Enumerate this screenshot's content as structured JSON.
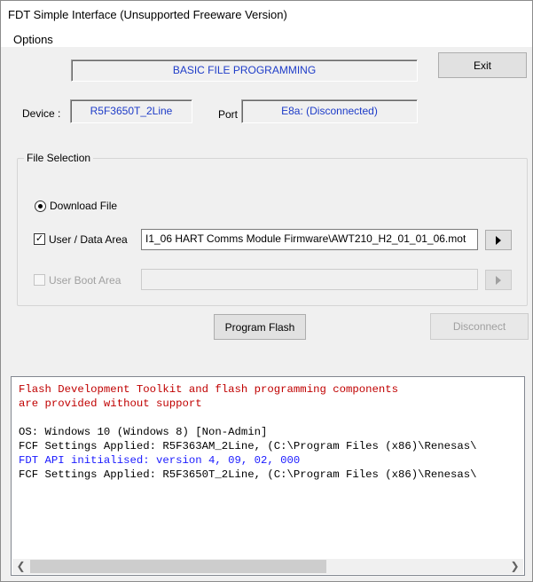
{
  "window": {
    "title": "FDT Simple Interface   (Unsupported Freeware Version)"
  },
  "menu": {
    "options": "Options"
  },
  "header": {
    "mode_text": "BASIC FILE PROGRAMMING",
    "exit_label": "Exit"
  },
  "device": {
    "label": "Device :",
    "value": "R5F3650T_2Line"
  },
  "port": {
    "label": "Port :",
    "value": "E8a: (Disconnected)"
  },
  "file_selection": {
    "title": "File Selection",
    "download_file_label": "Download File",
    "download_file_selected": true,
    "user_data_area": {
      "label": "User / Data Area",
      "checked": true,
      "path": "I1_06 HART Comms Module Firmware\\AWT210_H2_01_01_06.mot"
    },
    "user_boot_area": {
      "label": "User Boot Area",
      "checked": false,
      "enabled": false,
      "path": ""
    }
  },
  "actions": {
    "program_flash": "Program Flash",
    "disconnect": "Disconnect"
  },
  "log": {
    "lines": [
      {
        "text": "Flash Development Toolkit and flash programming components",
        "color": "#c00000"
      },
      {
        "text": "are provided without support",
        "color": "#c00000"
      },
      {
        "text": "",
        "color": "#000000"
      },
      {
        "text": "OS: Windows 10 (Windows 8) [Non-Admin]",
        "color": "#000000"
      },
      {
        "text": "FCF Settings Applied: R5F363AM_2Line, (C:\\Program Files (x86)\\Renesas\\",
        "color": "#000000"
      },
      {
        "text": "FDT API initialised: version 4, 09, 02, 000",
        "color": "#1a1aff"
      },
      {
        "text": "FCF Settings Applied: R5F3650T_2Line, (C:\\Program Files (x86)\\Renesas\\",
        "color": "#000000"
      }
    ],
    "scroll_left_icon": "chevron-left-icon",
    "scroll_right_icon": "chevron-right-icon"
  }
}
